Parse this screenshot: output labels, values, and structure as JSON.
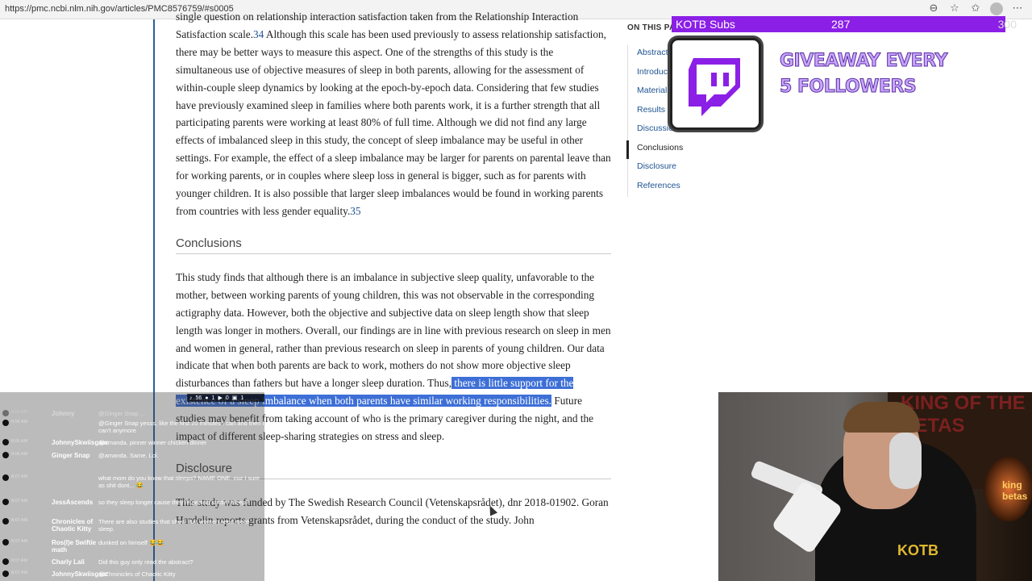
{
  "browser": {
    "url": "https://pmc.ncbi.nlm.nih.gov/articles/PMC8576759/#s0005"
  },
  "article": {
    "para1_lines": [
      "single question on relationship interaction satisfaction taken from the Relationship",
      "Interaction Satisfaction scale.",
      "34",
      " Although this scale has been used previously to assess relationship satisfaction, there may be better ways to measure this aspect. One of the strengths of this study is the simultaneous use of objective measures of sleep in both parents, allowing for the assessment of within-couple sleep dynamics by looking at the epoch-by-epoch data. Considering that few studies have previously examined sleep in families where both parents work, it is a further strength that all participating parents were working at least 80% of full time. Although we did not find any large effects of imbalanced sleep in this study, the concept of sleep imbalance may be useful in other settings. For example, the effect of a sleep imbalance may be larger for parents on parental leave than for working parents, or in couples where sleep loss in general is bigger, such as for parents with younger children. It is also possible that larger sleep imbalances would be found in working parents from countries with less gender equality.",
      "35"
    ],
    "conclusions_heading": "Conclusions",
    "conclusions_text_a": "This study finds that although there is an imbalance in subjective sleep quality, unfavorable to the mother, between working parents of young children, this was not observable in the corresponding actigraphy data. However, both the objective and subjective data on sleep length show that sleep length was longer in mothers. Overall, our findings are in line with previous research on sleep in men and women in general, rather than previous research on sleep in parents of young children. Our data indicate that when both parents are back to work, mothers do not show more objective sleep disturbances than fathers but have a longer sleep duration. Thus,",
    "conclusions_highlight": " there is little support for the existence of a sleep imbalance when both parents have similar working responsibilities.",
    "conclusions_text_b": " Future studies may benefit from taking account of who is the primary caregiver during the night, and the impact of different sleep-sharing strategies on stress and sleep.",
    "disclosure_heading": "Disclosure",
    "disclosure_text": "This study was funded by The Swedish Research Council (Vetenskapsrådet), dnr 2018-01902. Goran Hardelin reports grants from Vetenskapsrådet, during the conduct of the study. John"
  },
  "on_this_page": {
    "title": "ON THIS PA",
    "items": [
      "Abstract",
      "Introduction",
      "Materials",
      "Results",
      "Discussion",
      "Conclusions",
      "Disclosure",
      "References"
    ],
    "active_index": 5
  },
  "overlay": {
    "sub_label": "KOTB Subs",
    "sub_current": "287",
    "sub_goal": "300",
    "giveaway_line1": "GIVEAWAY EVERY",
    "giveaway_line2": "5 FOLLOWERS"
  },
  "chat": {
    "stats": [
      "56",
      "1",
      "0",
      "1"
    ],
    "messages": [
      {
        "time": "8:05 AM",
        "user": "Johnny",
        "msg": "@Ginger Snap ...",
        "dim": true
      },
      {
        "time": "8:06 AM",
        "user": "",
        "msg": "@Ginger Snap yesss, like the first 20 minutes I can and then I can't anymore"
      },
      {
        "time": "8:06 AM",
        "user": "JohnnySkwiisgaar",
        "msg": "@amanda. pinner winner chicken dinner"
      },
      {
        "time": "8:06 AM",
        "user": "Ginger Snap",
        "msg": "@amanda. Same. Lol."
      },
      {
        "time": "8:07 AM",
        "user": "",
        "msg": "what mom do you know that sleeps? NAME ONE. cuz I sure as shit dont... 😂"
      },
      {
        "time": "8:07 AM",
        "user": "JessAscends",
        "msg": "so they sleep longer cause they're getting shittier sleep?"
      },
      {
        "time": "8:07 AM",
        "user": "Chronicles of Chaotic Kitty",
        "msg": "There are also studies that show that women need more sleep."
      },
      {
        "time": "8:07 AM",
        "user": "Ros(I)e Swiftie math",
        "msg": "dunked on himself 😂😂"
      },
      {
        "time": "8:07 AM",
        "user": "Charly Lali",
        "msg": "Did this guy only read the abstract?"
      },
      {
        "time": "8:07 AM",
        "user": "JohnnySkwiisgaar",
        "msg": "@Chronicles of Chaotic Kitty"
      }
    ]
  },
  "webcam": {
    "sign_text": "KING OF THE BETAS",
    "shirt_logo": "KOTB",
    "glow_text": "king betas"
  }
}
